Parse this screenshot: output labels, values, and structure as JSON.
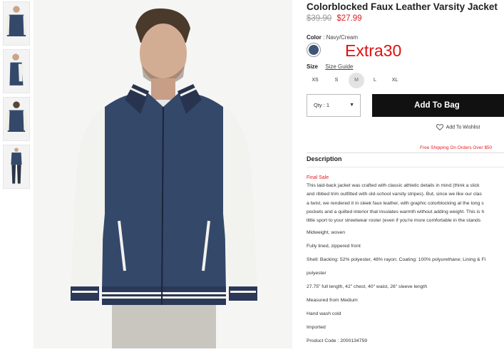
{
  "product": {
    "title": "Colorblocked Faux Leather Varsity Jacket",
    "old_price": "$39.90",
    "sale_price": "$27.99",
    "color_label": "Color",
    "color_value": ": Navy/Cream",
    "swatch_color": "#3e5478",
    "promo_text": "Extra30",
    "size_label": "Size",
    "size_guide": "Size Guide",
    "sizes": [
      "XS",
      "S",
      "M",
      "L",
      "XL"
    ],
    "selected_size": "M",
    "qty": "Qty : 1",
    "add_to_bag": "Add To Bag",
    "wishlist": "Add To Wishlist",
    "shipping": "Free Shipping On Orders Over $50"
  },
  "description": {
    "title": "Description",
    "final_sale": "Final Sale",
    "paragraph_lines": [
      "This laid-back jacket was crafted with classic athletic details in mind (think a slick",
      "and ribbed trim outfitted with old-school varsity stripes). But, since we like our clas",
      "a twist, we rendered it in sleek faux leather, with graphic colorblocking at the long s",
      "pockets and a quilted interior that insulates warmth without adding weight. This is h",
      "little sport to your streetwear roster (even if you're more comfortable in the stands"
    ],
    "details": [
      "Midweight, woven",
      "Fully lined, zippered front",
      "Shell: Backing: 52% polyester, 48% rayon; Coating: 100% polyurethane; Lining & Fi",
      "polyester",
      "27.75\" full length, 42\" chest, 40\" waist, 26\" sleeve length",
      "Measured from Medium",
      "Hand wash cold",
      "Imported",
      "Product Code : 2000134759"
    ]
  },
  "colors": {
    "sale": "#e21c22",
    "promo": "#e01010",
    "button_bg": "#111111",
    "jacket_navy": "#34486a",
    "sleeve_cream": "#f2f2ee"
  }
}
